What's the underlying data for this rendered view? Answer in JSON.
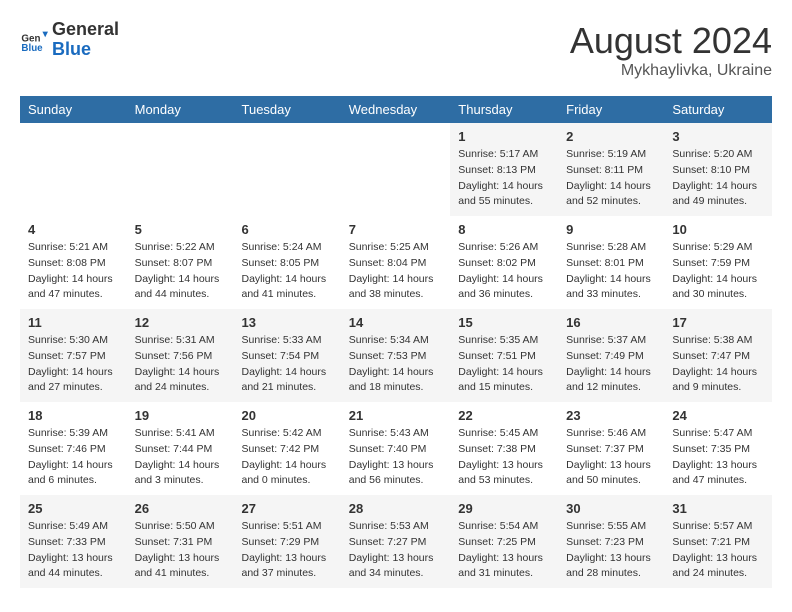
{
  "logo": {
    "general": "General",
    "blue": "Blue"
  },
  "title": {
    "month_year": "August 2024",
    "location": "Mykhaylivka, Ukraine"
  },
  "headers": [
    "Sunday",
    "Monday",
    "Tuesday",
    "Wednesday",
    "Thursday",
    "Friday",
    "Saturday"
  ],
  "weeks": [
    [
      {
        "day": "",
        "info": ""
      },
      {
        "day": "",
        "info": ""
      },
      {
        "day": "",
        "info": ""
      },
      {
        "day": "",
        "info": ""
      },
      {
        "day": "1",
        "info": "Sunrise: 5:17 AM\nSunset: 8:13 PM\nDaylight: 14 hours\nand 55 minutes."
      },
      {
        "day": "2",
        "info": "Sunrise: 5:19 AM\nSunset: 8:11 PM\nDaylight: 14 hours\nand 52 minutes."
      },
      {
        "day": "3",
        "info": "Sunrise: 5:20 AM\nSunset: 8:10 PM\nDaylight: 14 hours\nand 49 minutes."
      }
    ],
    [
      {
        "day": "4",
        "info": "Sunrise: 5:21 AM\nSunset: 8:08 PM\nDaylight: 14 hours\nand 47 minutes."
      },
      {
        "day": "5",
        "info": "Sunrise: 5:22 AM\nSunset: 8:07 PM\nDaylight: 14 hours\nand 44 minutes."
      },
      {
        "day": "6",
        "info": "Sunrise: 5:24 AM\nSunset: 8:05 PM\nDaylight: 14 hours\nand 41 minutes."
      },
      {
        "day": "7",
        "info": "Sunrise: 5:25 AM\nSunset: 8:04 PM\nDaylight: 14 hours\nand 38 minutes."
      },
      {
        "day": "8",
        "info": "Sunrise: 5:26 AM\nSunset: 8:02 PM\nDaylight: 14 hours\nand 36 minutes."
      },
      {
        "day": "9",
        "info": "Sunrise: 5:28 AM\nSunset: 8:01 PM\nDaylight: 14 hours\nand 33 minutes."
      },
      {
        "day": "10",
        "info": "Sunrise: 5:29 AM\nSunset: 7:59 PM\nDaylight: 14 hours\nand 30 minutes."
      }
    ],
    [
      {
        "day": "11",
        "info": "Sunrise: 5:30 AM\nSunset: 7:57 PM\nDaylight: 14 hours\nand 27 minutes."
      },
      {
        "day": "12",
        "info": "Sunrise: 5:31 AM\nSunset: 7:56 PM\nDaylight: 14 hours\nand 24 minutes."
      },
      {
        "day": "13",
        "info": "Sunrise: 5:33 AM\nSunset: 7:54 PM\nDaylight: 14 hours\nand 21 minutes."
      },
      {
        "day": "14",
        "info": "Sunrise: 5:34 AM\nSunset: 7:53 PM\nDaylight: 14 hours\nand 18 minutes."
      },
      {
        "day": "15",
        "info": "Sunrise: 5:35 AM\nSunset: 7:51 PM\nDaylight: 14 hours\nand 15 minutes."
      },
      {
        "day": "16",
        "info": "Sunrise: 5:37 AM\nSunset: 7:49 PM\nDaylight: 14 hours\nand 12 minutes."
      },
      {
        "day": "17",
        "info": "Sunrise: 5:38 AM\nSunset: 7:47 PM\nDaylight: 14 hours\nand 9 minutes."
      }
    ],
    [
      {
        "day": "18",
        "info": "Sunrise: 5:39 AM\nSunset: 7:46 PM\nDaylight: 14 hours\nand 6 minutes."
      },
      {
        "day": "19",
        "info": "Sunrise: 5:41 AM\nSunset: 7:44 PM\nDaylight: 14 hours\nand 3 minutes."
      },
      {
        "day": "20",
        "info": "Sunrise: 5:42 AM\nSunset: 7:42 PM\nDaylight: 14 hours\nand 0 minutes."
      },
      {
        "day": "21",
        "info": "Sunrise: 5:43 AM\nSunset: 7:40 PM\nDaylight: 13 hours\nand 56 minutes."
      },
      {
        "day": "22",
        "info": "Sunrise: 5:45 AM\nSunset: 7:38 PM\nDaylight: 13 hours\nand 53 minutes."
      },
      {
        "day": "23",
        "info": "Sunrise: 5:46 AM\nSunset: 7:37 PM\nDaylight: 13 hours\nand 50 minutes."
      },
      {
        "day": "24",
        "info": "Sunrise: 5:47 AM\nSunset: 7:35 PM\nDaylight: 13 hours\nand 47 minutes."
      }
    ],
    [
      {
        "day": "25",
        "info": "Sunrise: 5:49 AM\nSunset: 7:33 PM\nDaylight: 13 hours\nand 44 minutes."
      },
      {
        "day": "26",
        "info": "Sunrise: 5:50 AM\nSunset: 7:31 PM\nDaylight: 13 hours\nand 41 minutes."
      },
      {
        "day": "27",
        "info": "Sunrise: 5:51 AM\nSunset: 7:29 PM\nDaylight: 13 hours\nand 37 minutes."
      },
      {
        "day": "28",
        "info": "Sunrise: 5:53 AM\nSunset: 7:27 PM\nDaylight: 13 hours\nand 34 minutes."
      },
      {
        "day": "29",
        "info": "Sunrise: 5:54 AM\nSunset: 7:25 PM\nDaylight: 13 hours\nand 31 minutes."
      },
      {
        "day": "30",
        "info": "Sunrise: 5:55 AM\nSunset: 7:23 PM\nDaylight: 13 hours\nand 28 minutes."
      },
      {
        "day": "31",
        "info": "Sunrise: 5:57 AM\nSunset: 7:21 PM\nDaylight: 13 hours\nand 24 minutes."
      }
    ]
  ]
}
